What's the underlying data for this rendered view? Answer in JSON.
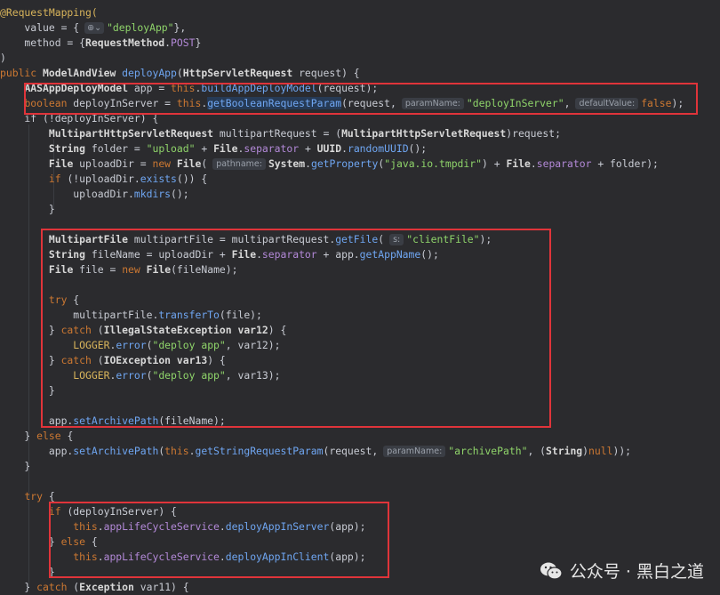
{
  "code": {
    "l01": {
      "a": "@RequestMapping("
    },
    "l02": {
      "a": "    value = {",
      "b": "\"deployApp\"",
      "c": "},"
    },
    "l03": {
      "a": "    method = {",
      "b": "RequestMethod",
      "c": ".",
      "d": "POST",
      "e": "}"
    },
    "l04": {
      "a": ")"
    },
    "l05": {
      "a": "public ",
      "b": "ModelAndView ",
      "c": "deployApp",
      "d": "(",
      "e": "HttpServletRequest",
      "f": " request) {"
    },
    "l06": {
      "a": "    ",
      "b": "AASAppDeployModel",
      "c": " app = ",
      "d": "this",
      "e": ".",
      "f": "buildAppDeployModel",
      "g": "(request);"
    },
    "l07": {
      "a": "    ",
      "b": "boolean",
      "c": " deployInServer = ",
      "d": "this",
      "e": ".",
      "f": "getBooleanRequestParam",
      "g": "(request,",
      "h1": "paramName:",
      "h": "\"deployInServer\"",
      "i": ",",
      "j1": "defaultValue:",
      "j": "false",
      "k": ");"
    },
    "l08": {
      "a": "    if (!deployInServer) {"
    },
    "l09": {
      "a": "        ",
      "b": "MultipartHttpServletRequest",
      "c": " multipartRequest = (",
      "d": "MultipartHttpServletRequest",
      "e": ")request;"
    },
    "l10": {
      "a": "        ",
      "b": "String",
      "c": " folder = ",
      "d": "\"upload\"",
      "e": " + ",
      "f": "File",
      "g": ".",
      "h": "separator",
      "i": " + ",
      "j": "UUID",
      "k": ".",
      "l": "randomUUID",
      "m": "();"
    },
    "l11": {
      "a": "        ",
      "b": "File",
      "c": " uploadDir = ",
      "d": "new ",
      "e": "File",
      "f": "(",
      "h1": "pathname:",
      "g": "System",
      "h": ".",
      "i": "getProperty",
      "j": "(",
      "k": "\"java.io.tmpdir\"",
      "l": ") + ",
      "m": "File",
      "n": ".",
      "o": "separator",
      "p": " + folder);"
    },
    "l12": {
      "a": "        ",
      "b": "if",
      "c": " (!uploadDir.",
      "d": "exists",
      "e": "()) {"
    },
    "l13": {
      "a": "            uploadDir.",
      "b": "mkdirs",
      "c": "();"
    },
    "l14": {
      "a": "        }"
    },
    "l16": {
      "a": "        ",
      "b": "MultipartFile",
      "c": " multipartFile = multipartRequest.",
      "d": "getFile",
      "e": "(",
      "h1": "s:",
      "f": "\"clientFile\"",
      "g": ");"
    },
    "l17": {
      "a": "        ",
      "b": "String",
      "c": " fileName = uploadDir + ",
      "d": "File",
      "e": ".",
      "f": "separator",
      "g": " + app.",
      "h": "getAppName",
      "i": "();"
    },
    "l18": {
      "a": "        ",
      "b": "File",
      "c": " file = ",
      "d": "new ",
      "e": "File",
      "f": "(fileName);"
    },
    "l20": {
      "a": "        ",
      "b": "try",
      "c": " {"
    },
    "l21": {
      "a": "            multipartFile.",
      "b": "transferTo",
      "c": "(file);"
    },
    "l22": {
      "a": "        } ",
      "b": "catch",
      "c": " (",
      "d": "IllegalStateException",
      "e": " ",
      "f": "var12",
      "g": ") {"
    },
    "l23": {
      "a": "            ",
      "b": "LOGGER",
      "c": ".",
      "d": "error",
      "e": "(",
      "f": "\"deploy app\"",
      "g": ", ",
      "h": "var12",
      "i": ");"
    },
    "l24": {
      "a": "        } ",
      "b": "catch",
      "c": " (",
      "d": "IOException",
      "e": " ",
      "f": "var13",
      "g": ") {"
    },
    "l25": {
      "a": "            ",
      "b": "LOGGER",
      "c": ".",
      "d": "error",
      "e": "(",
      "f": "\"deploy app\"",
      "g": ", ",
      "h": "var13",
      "i": ");"
    },
    "l26": {
      "a": "        }"
    },
    "l28": {
      "a": "        app.",
      "b": "setArchivePath",
      "c": "(fileName);"
    },
    "l29": {
      "a": "    } ",
      "b": "else",
      "c": " {"
    },
    "l30": {
      "a": "        app.",
      "b": "setArchivePath",
      "c": "(",
      "d": "this",
      "e": ".",
      "f": "getStringRequestParam",
      "g": "(request,",
      "h1": "paramName:",
      "h": "\"archivePath\"",
      "i": ", (",
      "j": "String",
      "k": ")",
      "l": "null",
      "m": "));"
    },
    "l31": {
      "a": "    }"
    },
    "l33": {
      "a": "    ",
      "b": "try",
      "c": " {"
    },
    "l34": {
      "a": "        ",
      "b": "if",
      "c": " (deployInServer) {"
    },
    "l35": {
      "a": "            ",
      "b": "this",
      "c": ".",
      "d": "appLifeCycleService",
      "e": ".",
      "f": "deployAppInServer",
      "g": "(app);"
    },
    "l36": {
      "a": "        } ",
      "b": "else",
      "c": " {"
    },
    "l37": {
      "a": "            ",
      "b": "this",
      "c": ".",
      "d": "appLifeCycleService",
      "e": ".",
      "f": "deployAppInClient",
      "g": "(app);"
    },
    "l38": {
      "a": "        }"
    },
    "l39": {
      "a": "    } ",
      "b": "catch",
      "c": " (",
      "d": "Exception",
      "e": " var11) {"
    }
  },
  "watermark": {
    "text": "公众号 · 黑白之道",
    "icon": "wechat-icon"
  },
  "colors": {
    "background": "#2b2b2e",
    "highlight_box": "#e0343a",
    "keyword": "#cc7832",
    "method": "#6fa6f2",
    "string": "#8fd46a",
    "field": "#b389d8",
    "annotation": "#d8b45b"
  }
}
